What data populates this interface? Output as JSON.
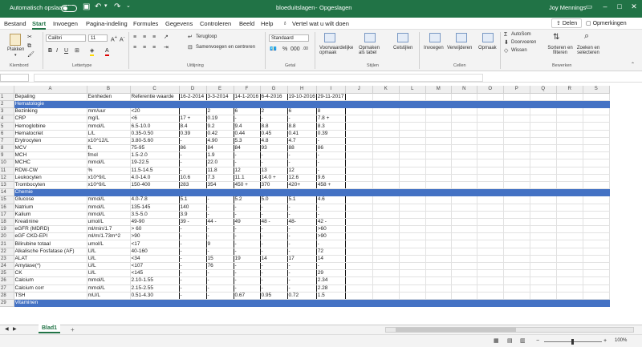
{
  "title_bar": {
    "autosave_label": "Automatisch opslaan",
    "autosave_state": "Uit",
    "filename": "bloeduitslagen",
    "status": "Opgeslagen",
    "user": "Joy Mennings"
  },
  "menu": {
    "tabs": [
      "Bestand",
      "Start",
      "Invoegen",
      "Pagina-indeling",
      "Formules",
      "Gegevens",
      "Controleren",
      "Beeld",
      "Help"
    ],
    "active_tab": "Start",
    "tell_me": "Vertel wat u wilt doen",
    "share_label": "Delen",
    "comments_label": "Opmerkingen"
  },
  "ribbon": {
    "clipboard": {
      "paste": "Plakken",
      "label": "Klembord"
    },
    "font": {
      "name": "Calibri",
      "size": "11",
      "label": "Lettertype"
    },
    "alignment": {
      "wrap": "Terugloop",
      "merge": "Samenvoegen en centreren",
      "label": "Uitlijning"
    },
    "number": {
      "format": "Standaard",
      "label": "Getal"
    },
    "styles": {
      "conditional": "Voorwaardelijke opmaak",
      "table": "Opmaken als tabel",
      "cell_styles": "Celstijlen",
      "label": "Stijlen"
    },
    "cells": {
      "insert": "Invoegen",
      "delete": "Verwijderen",
      "format": "Opmaak",
      "label": "Cellen"
    },
    "editing": {
      "autosum": "AutoSom",
      "fill": "Doorvoeren",
      "clear": "Wissen",
      "sort": "Sorteren en filteren",
      "find": "Zoeken en selecteren",
      "label": "Bewerken"
    }
  },
  "sheet": {
    "columns": [
      "A",
      "B",
      "C",
      "D",
      "E",
      "F",
      "G",
      "H",
      "I",
      "J",
      "K",
      "L",
      "M",
      "N",
      "O",
      "P",
      "Q",
      "R",
      "S"
    ],
    "rows": [
      {
        "n": "1",
        "cells": [
          "Bepaling",
          "Eenheden",
          "Referentie waarde",
          "16-2-2014",
          "3-3-2014",
          "14-1-2016",
          "6-4-2016",
          "19-10-2016",
          "29-11-2017"
        ]
      },
      {
        "n": "2",
        "section": true,
        "cells": [
          "Hematologie",
          "",
          "",
          "",
          "",
          "",
          "",
          "",
          ""
        ]
      },
      {
        "n": "3",
        "cells": [
          "Bezinking",
          "mm/uur",
          "<20",
          "",
          "2",
          "6",
          "2",
          "6",
          "8"
        ]
      },
      {
        "n": "4",
        "cells": [
          "CRP",
          "mg/L",
          "<6",
          "17 +",
          "0.19",
          "-",
          "-",
          "-",
          "7.8 +"
        ]
      },
      {
        "n": "5",
        "cells": [
          "Hemoglobine",
          "mmol/L",
          "6.5-10.0",
          "8.4",
          "9.2",
          "9.4",
          "8.8",
          "8.8",
          "8.3"
        ]
      },
      {
        "n": "6",
        "cells": [
          "Hematocriet",
          "L/L",
          "0.35-0.50",
          "0.39",
          "0.42",
          "0.44",
          "0.45",
          "0.41",
          "0.39"
        ]
      },
      {
        "n": "7",
        "cells": [
          "Erytrocyten",
          "x10^12/L",
          "3.80-5.60",
          "-",
          "4.90",
          "5.3",
          "4.8",
          "4.7",
          "-"
        ]
      },
      {
        "n": "8",
        "cells": [
          "MCV",
          "fL",
          "75-95",
          "86",
          "84",
          "84",
          "93",
          "88",
          "86"
        ]
      },
      {
        "n": "9",
        "cells": [
          "MCH",
          "fmol",
          "1.5-2.0",
          "-",
          "1.9",
          "-",
          "-",
          "-",
          "-"
        ]
      },
      {
        "n": "10",
        "cells": [
          "MCHC",
          "mmol/L",
          "19-22.5",
          "-",
          "22.0",
          "-",
          "-",
          "-",
          "-"
        ]
      },
      {
        "n": "11",
        "cells": [
          "RDW-CW",
          "%",
          "11.5-14.5",
          "-",
          "11.8",
          "12",
          "13",
          "12",
          "-"
        ]
      },
      {
        "n": "12",
        "cells": [
          "Leukocyten",
          "x10^9/L",
          "4.0-14.0",
          "10.6",
          "7.3",
          "11.1",
          "14.0 +",
          "12.6",
          "9.6"
        ]
      },
      {
        "n": "13",
        "cells": [
          "Trombocyten",
          "x10^9/L",
          "150-400",
          "283",
          "354",
          "450 +",
          "370",
          "420+",
          "458 +"
        ]
      },
      {
        "n": "14",
        "section": true,
        "cells": [
          "Chemie",
          "",
          "",
          "",
          "",
          "",
          "",
          "",
          ""
        ]
      },
      {
        "n": "15",
        "cells": [
          "Glucose",
          "mmol/L",
          "4.0-7.8",
          "5.1",
          "-",
          "5.2",
          "5.0",
          "5.1",
          "4.6"
        ]
      },
      {
        "n": "16",
        "cells": [
          "Natrium",
          "mmol/L",
          "135-145",
          "140",
          "-",
          "-",
          "-",
          "-",
          "-"
        ]
      },
      {
        "n": "17",
        "cells": [
          "Kalium",
          "mmol/L",
          "3.5-5.0",
          "3.9",
          "-",
          "-",
          "-",
          "-",
          "-"
        ]
      },
      {
        "n": "18",
        "cells": [
          "Kreatinine",
          "umol/L",
          "49-90",
          "39 -",
          "44 -",
          "49",
          "48 -",
          "48-",
          "42 -"
        ]
      },
      {
        "n": "19",
        "cells": [
          "eGFR (MDRD)",
          "ml/min/1.7",
          "> 60",
          "-",
          "-",
          "-",
          "-",
          "-",
          ">60"
        ]
      },
      {
        "n": "20",
        "cells": [
          "eGF CKD-EPI",
          "ml/m/1.73m^2",
          ">90",
          "-",
          "-",
          "-",
          "-",
          "-",
          ">90"
        ]
      },
      {
        "n": "21",
        "cells": [
          "Bilirubine totaal",
          "umol/L",
          "<17",
          "-",
          "9",
          "-",
          "-",
          "-",
          "-"
        ]
      },
      {
        "n": "22",
        "cells": [
          "Alkalische Fosfatase (AF)",
          "U/L",
          "40-160",
          "-",
          "-",
          "-",
          "-",
          "-",
          "72"
        ]
      },
      {
        "n": "23",
        "cells": [
          "ALAT",
          "U/L",
          "<34",
          "-",
          "15",
          "19",
          "14",
          "17",
          "14"
        ]
      },
      {
        "n": "24",
        "cells": [
          "Amytase(*)",
          "U/L",
          "<107",
          "-",
          "76",
          "-",
          "-",
          "-",
          "-"
        ]
      },
      {
        "n": "25",
        "cells": [
          "CK",
          "U/L",
          "<145",
          "-",
          "-",
          "-",
          "-",
          "-",
          "29"
        ]
      },
      {
        "n": "26",
        "cells": [
          "Calcium",
          "mmol/L",
          "2.10-1.55",
          "-",
          "-",
          "-",
          "-",
          "-",
          "2.34"
        ]
      },
      {
        "n": "27",
        "cells": [
          "Calcium corr",
          "mmol/L",
          "2.15-2.55",
          "-",
          "-",
          "-",
          "-",
          "-",
          "2.28"
        ]
      },
      {
        "n": "28",
        "cells": [
          "TSH",
          "mU/L",
          "0.51-4.30",
          "-",
          "-",
          "0.67",
          "0.95",
          "0.72",
          "1.5"
        ]
      },
      {
        "n": "29",
        "section": true,
        "cells": [
          "Vitaminen",
          "",
          "",
          "",
          "",
          "",
          "",
          "",
          ""
        ]
      }
    ]
  },
  "sheet_tabs": {
    "active": "Blad1",
    "add": "+"
  },
  "status_bar": {
    "zoom": "100%"
  }
}
